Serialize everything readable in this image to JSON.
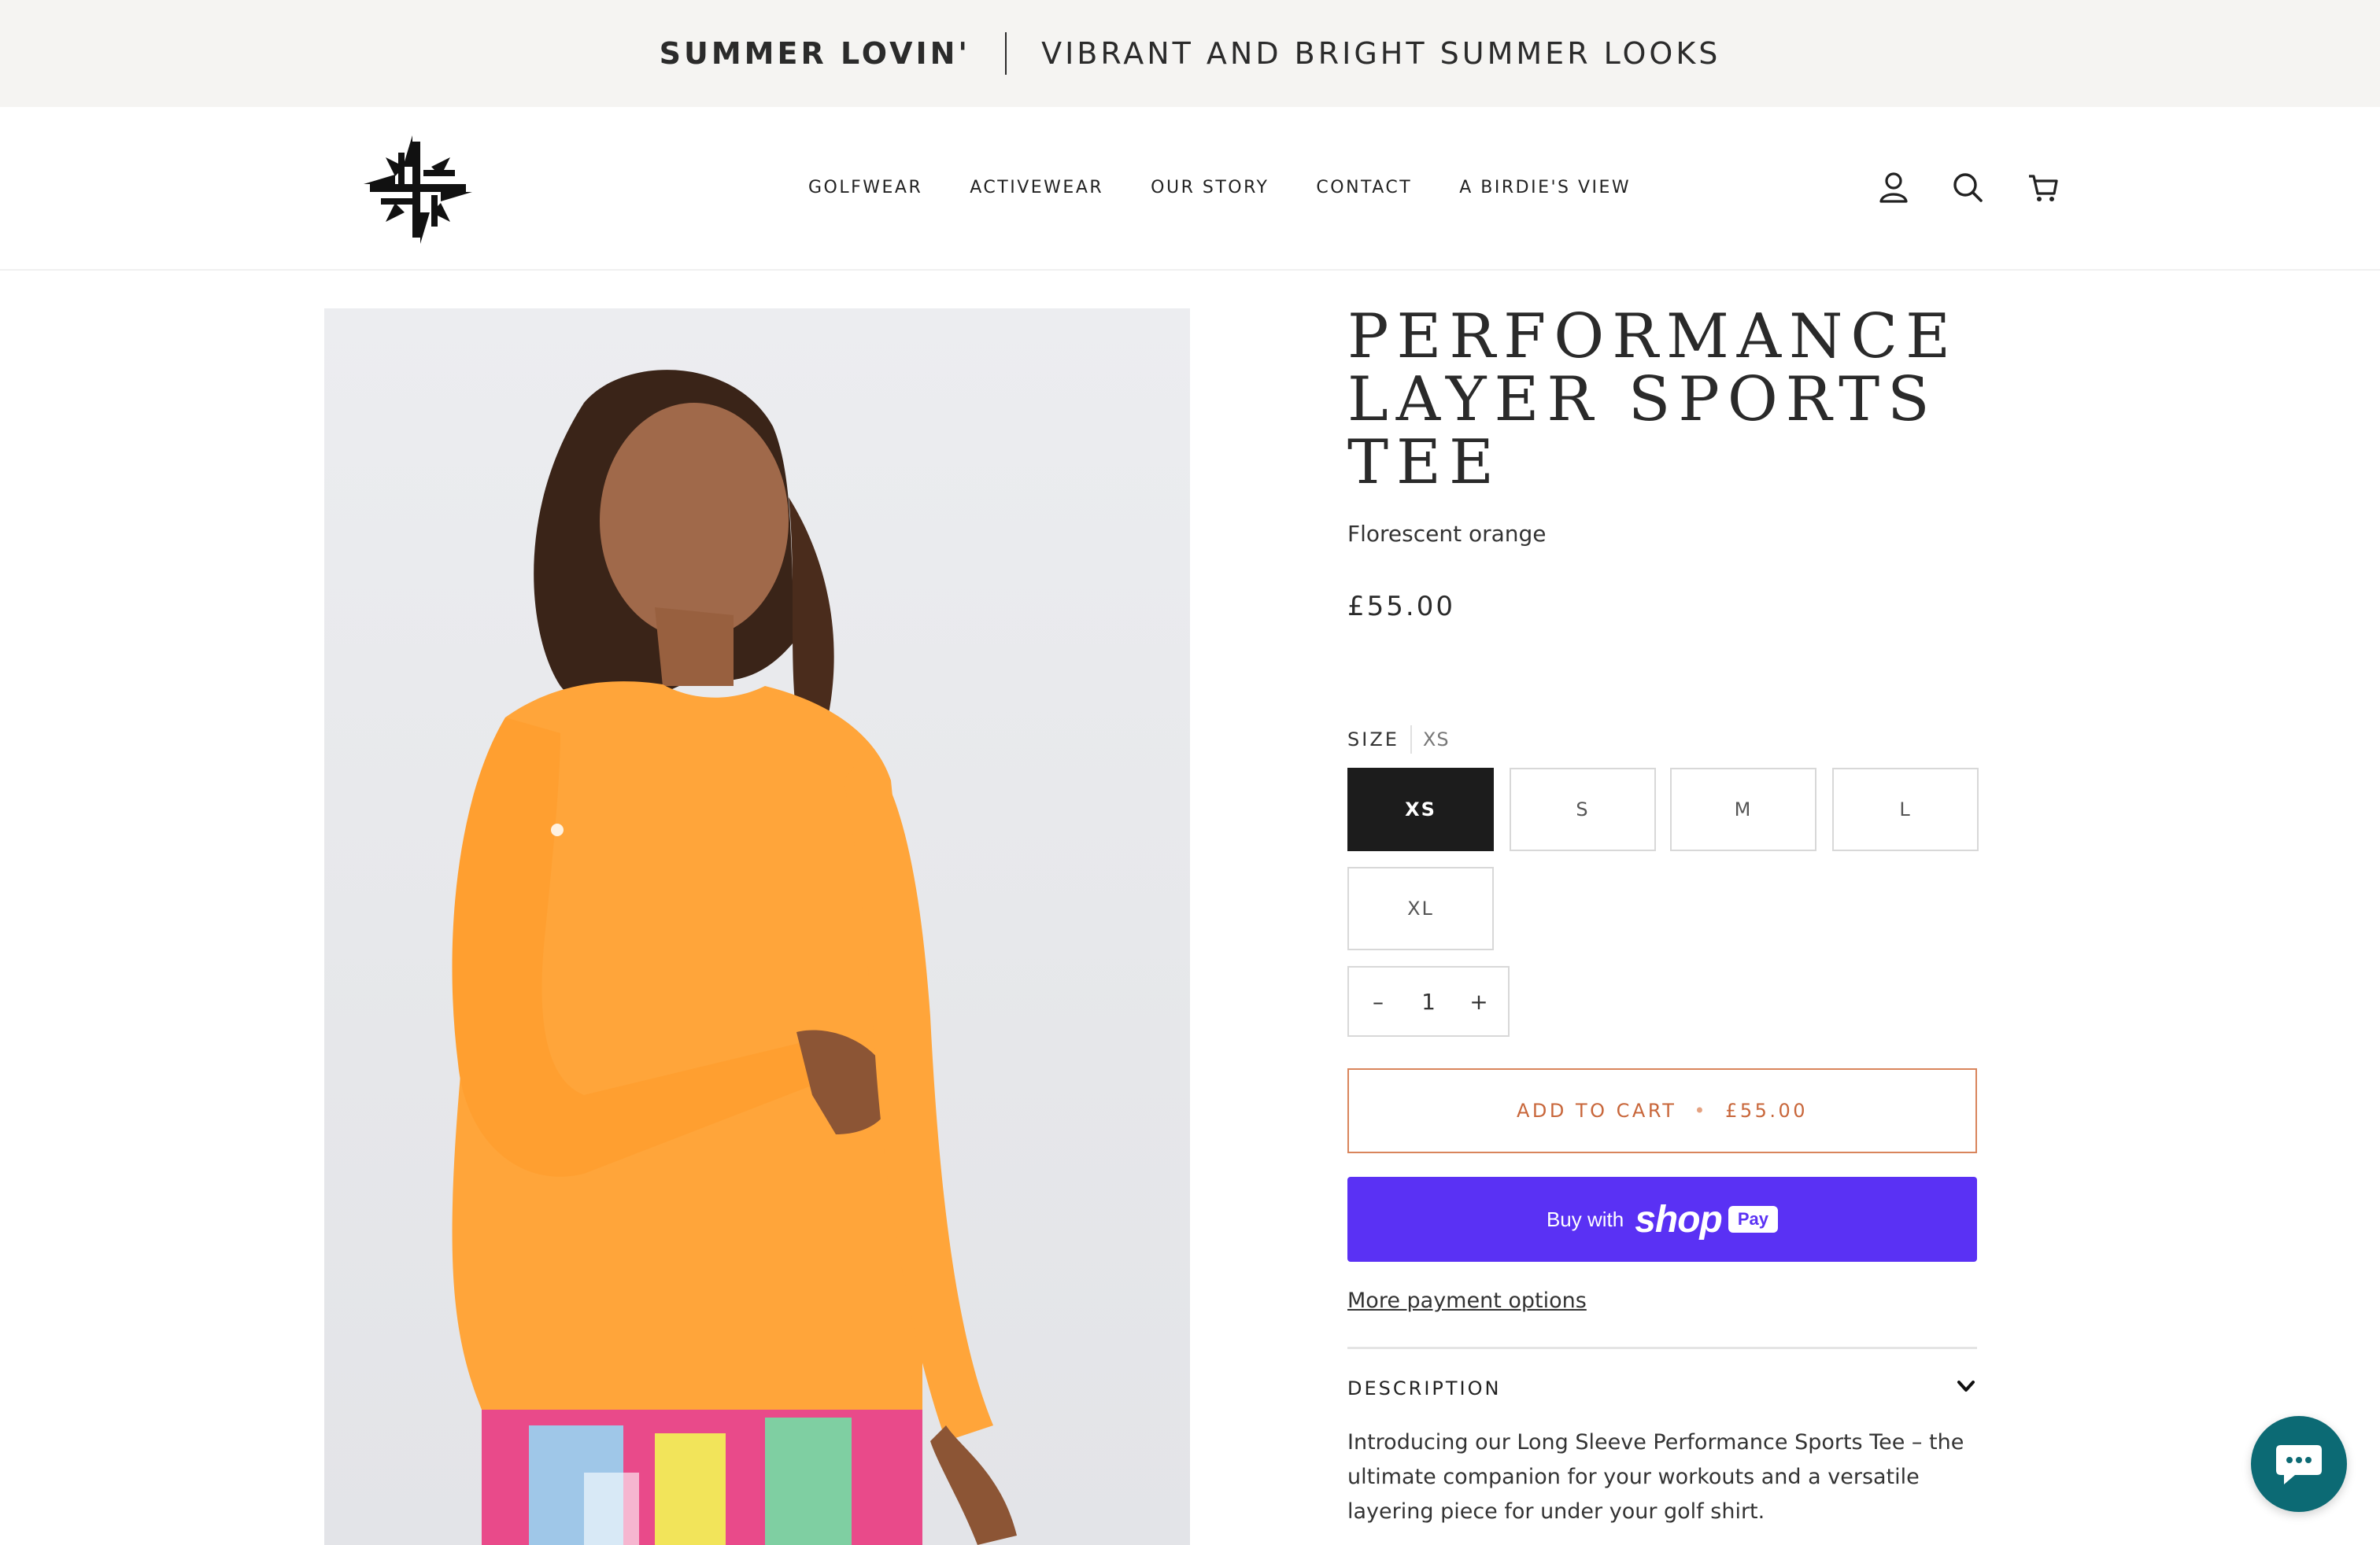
{
  "announcement": {
    "headline": "SUMMER LOVIN'",
    "tagline": "VIBRANT AND BRIGHT SUMMER LOOKS"
  },
  "header": {
    "logo_icon": "brand-star-logo",
    "nav": [
      {
        "label": "GOLFWEAR"
      },
      {
        "label": "ACTIVEWEAR"
      },
      {
        "label": "OUR STORY"
      },
      {
        "label": "CONTACT"
      },
      {
        "label": "A BIRDIE'S VIEW"
      }
    ],
    "icons": [
      "account-icon",
      "search-icon",
      "cart-icon"
    ]
  },
  "product": {
    "image_alt": "woman-in-orange-long-sleeve-tee",
    "title": "PERFORMANCE LAYER SPORTS TEE",
    "color": "Florescent orange",
    "price": "£55.00",
    "size": {
      "label": "SIZE",
      "selected": "XS",
      "options": [
        "XS",
        "S",
        "M",
        "L",
        "XL"
      ]
    },
    "quantity": {
      "minus": "–",
      "value": "1",
      "plus": "+"
    },
    "add_to_cart": {
      "label": "ADD TO CART",
      "separator": "•",
      "price": "£55.00"
    },
    "shop_pay": {
      "prefix": "Buy with",
      "brand": "shop",
      "badge": "Pay"
    },
    "more_payment": "More payment options",
    "description": {
      "heading": "DESCRIPTION",
      "text": "Introducing our Long Sleeve Performance Sports Tee – the ultimate companion for your workouts and a versatile layering piece for under your golf shirt."
    }
  },
  "colors": {
    "accent_atc": "#c8663a",
    "shop_pay": "#5a31f4",
    "chat": "#0c6a74",
    "selected_size": "#1c1c1c"
  },
  "chat_icon": "chat-bubble-icon"
}
